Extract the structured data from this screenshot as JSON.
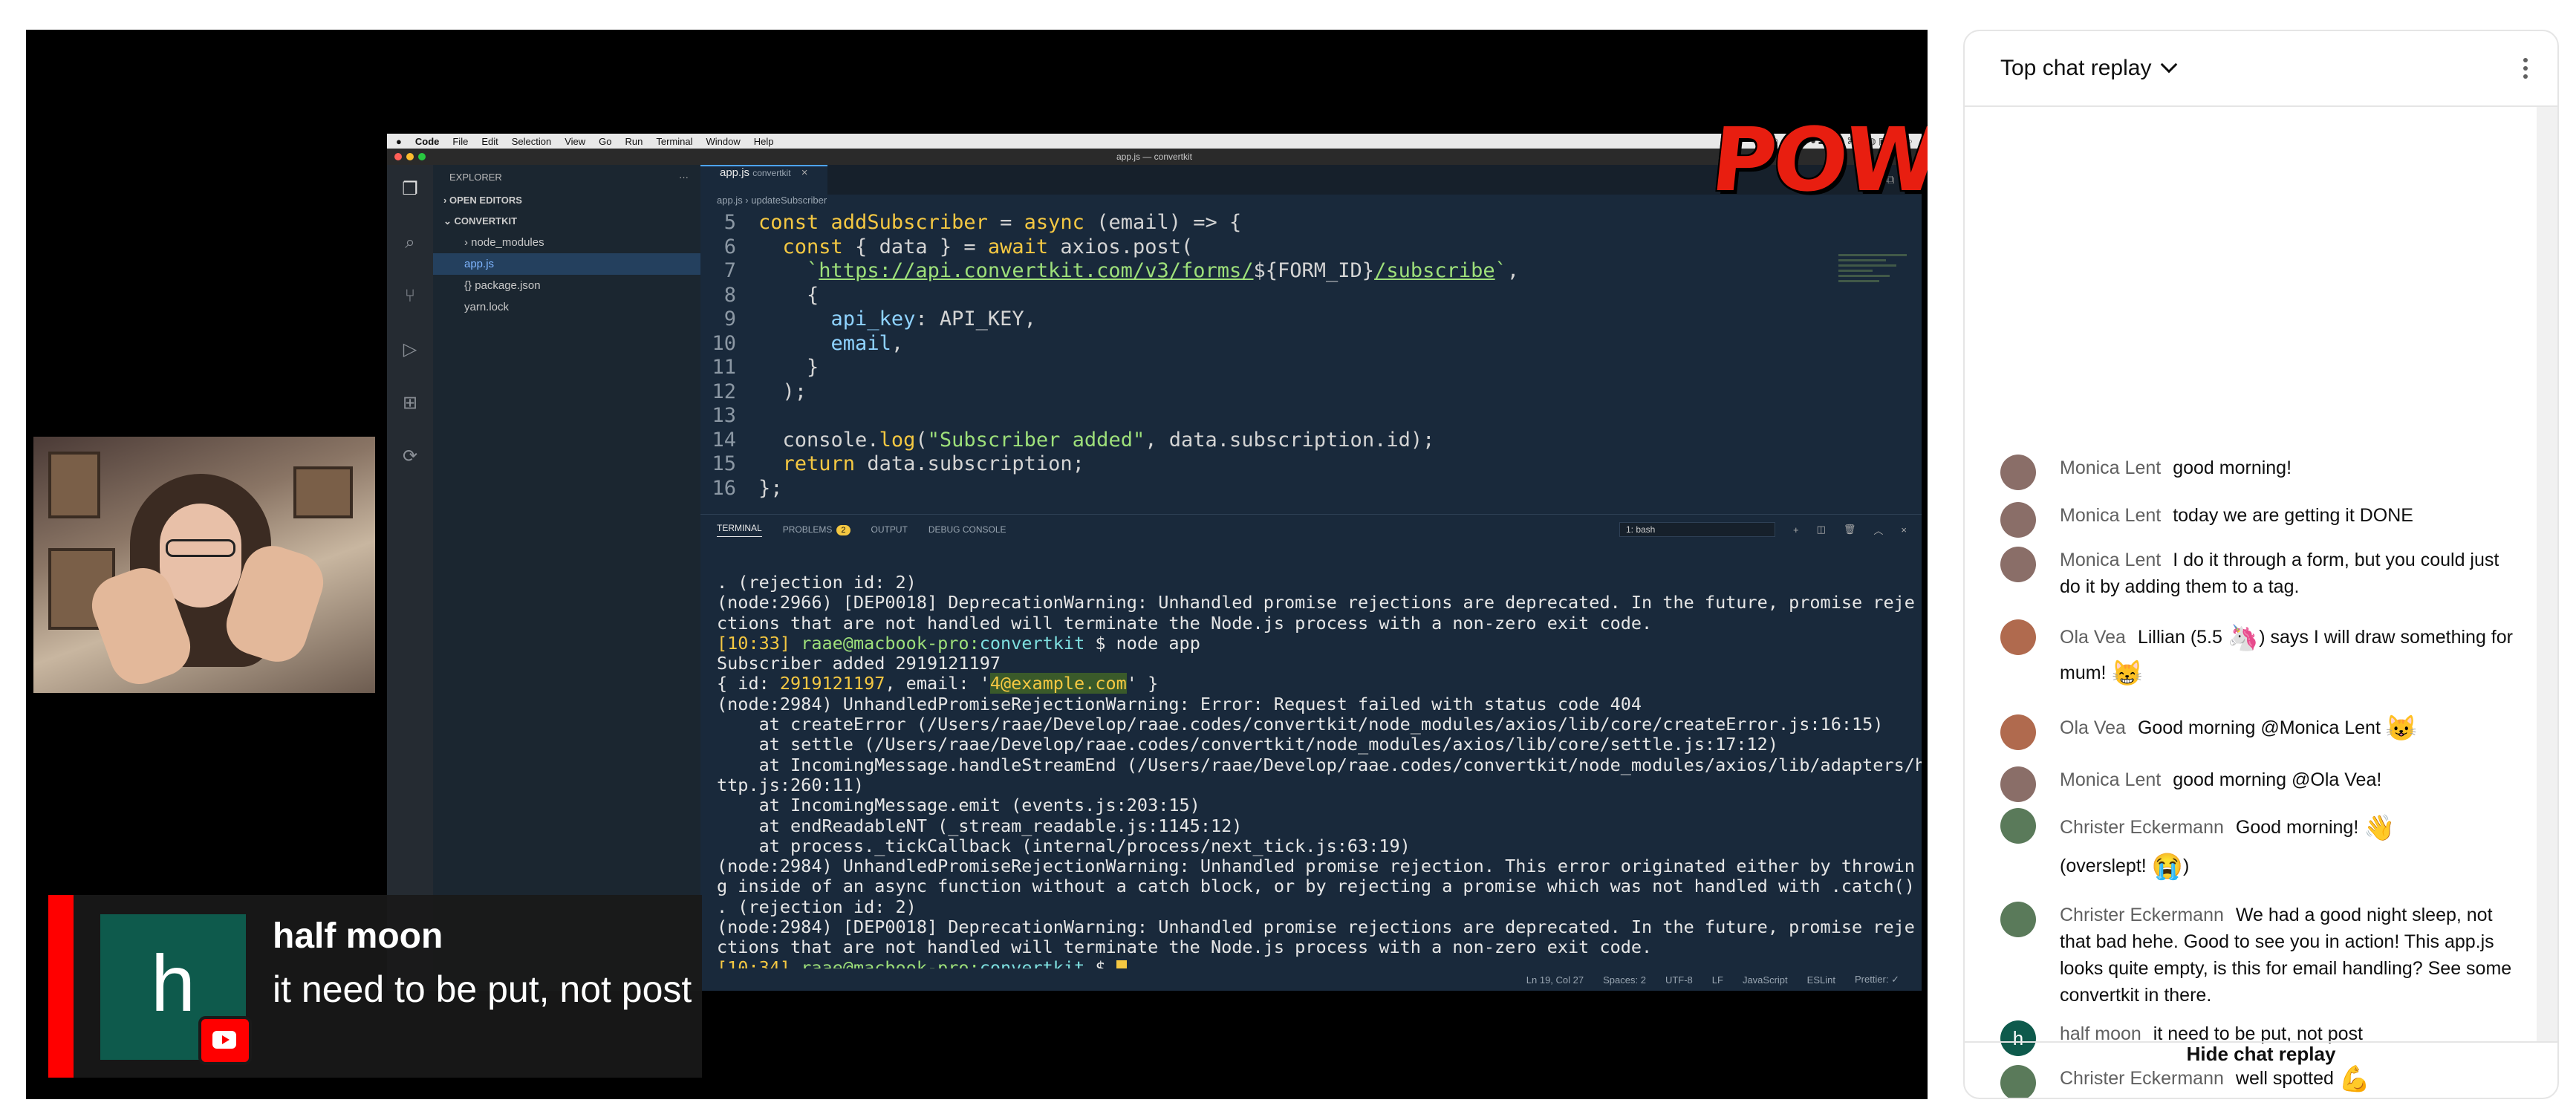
{
  "mac": {
    "menu": [
      "Code",
      "File",
      "Edit",
      "Selection",
      "View",
      "Go",
      "Run",
      "Terminal",
      "Window",
      "Help"
    ],
    "window_title": "app.js — convertkit"
  },
  "explorer": {
    "title": "EXPLORER",
    "open_editors": "OPEN EDITORS",
    "project": "CONVERTKIT",
    "files": [
      "node_modules",
      "app.js",
      "package.json",
      "yarn.lock"
    ]
  },
  "editor": {
    "tab": "app.js",
    "tab_sub": "convertkit",
    "breadcrumb": "app.js › updateSubscriber",
    "line_numbers": [
      "5",
      "6",
      "7",
      "8",
      "9",
      "10",
      "11",
      "12",
      "13",
      "14",
      "15",
      "16"
    ]
  },
  "panel": {
    "tabs": [
      "TERMINAL",
      "PROBLEMS",
      "OUTPUT",
      "DEBUG CONSOLE"
    ],
    "problems_count": "2",
    "terminal_select": "1: bash"
  },
  "terminal_lines": [
    ". (rejection id: 2)",
    "(node:2966) [DEP0018] DeprecationWarning: Unhandled promise rejections are deprecated. In the future, promise reje",
    "ctions that are not handled will terminate the Node.js process with a non-zero exit code.",
    "Subscriber added 2919121197",
    "(node:2984) UnhandledPromiseRejectionWarning: Error: Request failed with status code 404",
    "    at createError (/Users/raae/Develop/raae.codes/convertkit/node_modules/axios/lib/core/createError.js:16:15)",
    "    at settle (/Users/raae/Develop/raae.codes/convertkit/node_modules/axios/lib/core/settle.js:17:12)",
    "    at IncomingMessage.handleStreamEnd (/Users/raae/Develop/raae.codes/convertkit/node_modules/axios/lib/adapters/h",
    "ttp.js:260:11)",
    "    at IncomingMessage.emit (events.js:203:15)",
    "    at endReadableNT (_stream_readable.js:1145:12)",
    "    at process._tickCallback (internal/process/next_tick.js:63:19)",
    "(node:2984) UnhandledPromiseRejectionWarning: Unhandled promise rejection. This error originated either by throwin",
    "g inside of an async function without a catch block, or by rejecting a promise which was not handled with .catch()",
    ". (rejection id: 2)",
    "(node:2984) [DEP0018] DeprecationWarning: Unhandled promise rejections are deprecated. In the future, promise reje",
    "ctions that are not handled will terminate the Node.js process with a non-zero exit code."
  ],
  "terminal": {
    "prompt1_time": "[10:33]",
    "prompt1_user": "raae@macbook-pro:",
    "prompt1_dir": "convertkit",
    "prompt1_cmd": " $ node app",
    "result_pre": "{ id: ",
    "result_id": "2919121197",
    "result_mid": ", email: '",
    "result_email": "4@example.com",
    "result_post": "' }",
    "prompt2_time": "[10:34]",
    "prompt2_user": "raae@macbook-pro:",
    "prompt2_dir": "convertkit",
    "prompt2_tail": " $ "
  },
  "statusbar": [
    "Ln 19, Col 27",
    "Spaces: 2",
    "UTF-8",
    "LF",
    "JavaScript",
    "ESLint",
    "Prettier: ✓"
  ],
  "overlay": {
    "pow": "POW!",
    "lower_third": {
      "avatar_letter": "h",
      "name": "half moon",
      "message": "it need to be put, not post"
    }
  },
  "chat": {
    "title": "Top chat replay",
    "messages": [
      {
        "author": "Monica Lent",
        "text": "good morning!",
        "avatar_color": "#8a6e68"
      },
      {
        "author": "Monica Lent",
        "text": "today we are getting it DONE",
        "avatar_color": "#8a6e68"
      },
      {
        "author": "Monica Lent",
        "text": "I do it through a form, but you could just do it by adding them to a tag.",
        "avatar_color": "#8a6e68"
      },
      {
        "author": "Ola Vea",
        "text": "Lillian (5.5",
        "text2": ") says I will draw something for mum!",
        "avatar_color": "#b06a4e"
      },
      {
        "author": "Ola Vea",
        "text": "Good morning @Monica Lent",
        "avatar_color": "#b06a4e"
      },
      {
        "author": "Monica Lent",
        "text": "good morning @Ola Vea!",
        "avatar_color": "#8a6e68"
      },
      {
        "author": "Christer Eckermann",
        "text": "Good morning!",
        "text2": "(overslept!",
        "text3": ")",
        "avatar_color": "#5a7a5a"
      },
      {
        "author": "Christer Eckermann",
        "text": "We had a good night sleep, not that bad hehe. Good to see you in action! This app.js looks quite empty, is this for email handling? See some convertkit in there.",
        "avatar_color": "#5a7a5a"
      },
      {
        "author": "half moon",
        "text": "it need to be put, not post",
        "avatar_color": "#0e5a4c",
        "avatar_letter": "h"
      },
      {
        "author": "Christer Eckermann",
        "text": "well spotted",
        "avatar_color": "#5a7a5a"
      }
    ],
    "emojis": {
      "unicorn": "🦄",
      "cat_smile": "😸",
      "cat_happy": "😺",
      "wave": "👋",
      "cry": "😭",
      "muscle": "💪"
    },
    "footer": "Hide chat replay"
  }
}
